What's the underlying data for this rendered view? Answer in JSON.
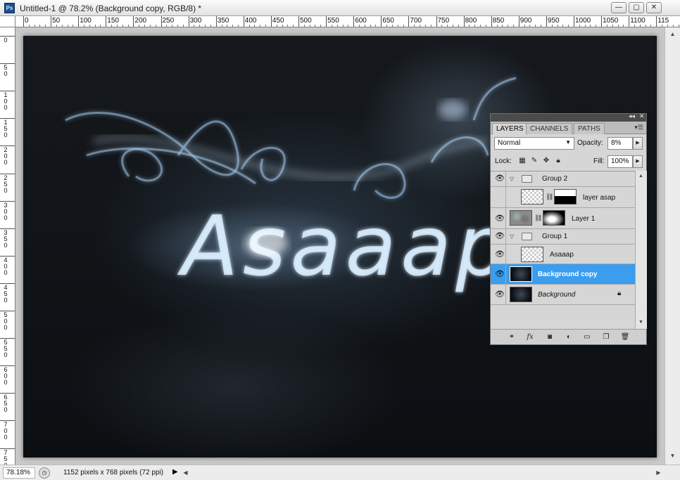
{
  "window": {
    "title": "Untitled-1 @ 78.2% (Background copy, RGB/8) *",
    "app_icon": "Ps",
    "minimize": "—",
    "maximize": "▢",
    "close": "✕"
  },
  "ruler": {
    "top_ticks": [
      "0",
      "50",
      "100",
      "150",
      "200",
      "250",
      "300",
      "350",
      "400",
      "450",
      "500",
      "550",
      "600",
      "650",
      "700",
      "750",
      "800",
      "850",
      "900",
      "950",
      "1000",
      "1050",
      "1100",
      "115"
    ],
    "left_ticks": [
      "0",
      "5 0",
      "1 0 0",
      "1 5 0",
      "2 0 0",
      "2 5 0",
      "3 0 0",
      "3 5 0",
      "4 0 0",
      "4 5 0",
      "5 0 0",
      "5 5 0",
      "6 0 0",
      "6 5 0",
      "7 0 0",
      "7 5 0"
    ]
  },
  "canvas": {
    "artwork_text": "Asaaap"
  },
  "status": {
    "zoom": "78.18%",
    "doc_info": "1152 pixels x 768 pixels (72 ppi)",
    "arrow": "▶"
  },
  "layers_panel": {
    "collapse": "◂◂",
    "close": "✕",
    "tabs": [
      "LAYERS",
      "CHANNELS",
      "PATHS"
    ],
    "active_tab": "LAYERS",
    "blend_mode": "Normal",
    "opacity_label": "Opacity:",
    "opacity_value": "8%",
    "lock_label": "Lock:",
    "fill_label": "Fill:",
    "fill_value": "100%",
    "layers": [
      {
        "name": "Group 2",
        "type": "group",
        "visible": true
      },
      {
        "name": "layer asap",
        "type": "masked",
        "visible": false
      },
      {
        "name": "Layer 1",
        "type": "masked",
        "visible": true
      },
      {
        "name": "Group 1",
        "type": "group",
        "visible": true
      },
      {
        "name": "Asaaap",
        "type": "layer",
        "visible": true
      },
      {
        "name": "Background copy",
        "type": "layer",
        "visible": true,
        "selected": true
      },
      {
        "name": "Background",
        "type": "background",
        "visible": true,
        "locked": true
      }
    ],
    "bottom_icons": [
      "link-layers-icon",
      "fx-icon",
      "add-mask-icon",
      "adjustment-layer-icon",
      "new-group-icon",
      "new-layer-icon",
      "delete-layer-icon"
    ]
  }
}
